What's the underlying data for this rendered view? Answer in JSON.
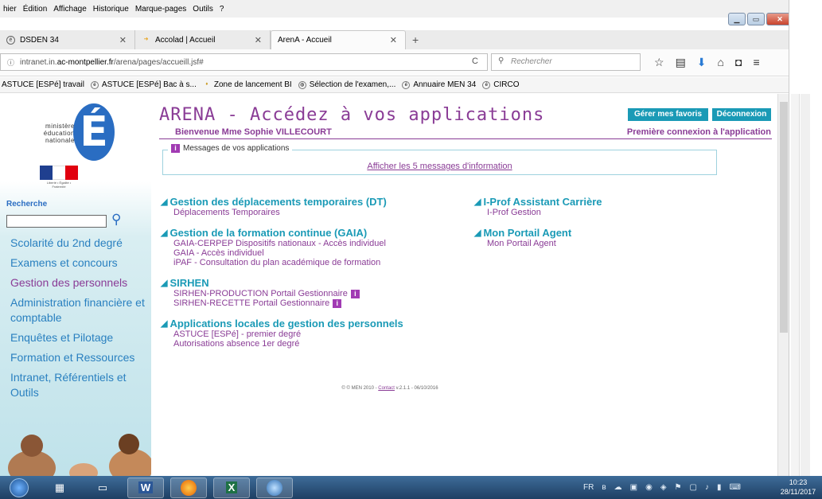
{
  "browser": {
    "menu": [
      "hier",
      "Édition",
      "Affichage",
      "Historique",
      "Marque-pages",
      "Outils",
      "?"
    ],
    "tabs": [
      {
        "label": "DSDEN 34"
      },
      {
        "label": "Accolad | Accueil"
      },
      {
        "label": "ArenA - Accueil"
      }
    ],
    "url_prefix": "intranet.in.",
    "url_domain": "ac-montpellier.fr",
    "url_path": "/arena/pages/accueill.jsf#",
    "search_placeholder": "Rechercher",
    "bookmarks": [
      "ASTUCE [ESPé] travail",
      "ASTUCE [ESPé] Bac à s...",
      "Zone de lancement BI",
      "Sélection de l'examen,...",
      "Annuaire MEN 34",
      "CIRCO"
    ]
  },
  "sidebar": {
    "logo_text": "ministère éducation nationale",
    "logo_letter": "É",
    "marianne_caption": "Liberté • Égalité • Fraternité RÉPUBLIQUE FRANÇAISE",
    "search_label": "Recherche",
    "menu": [
      "Scolarité du 2nd degré",
      "Examens et concours",
      "Gestion des personnels",
      "Administration financière et comptable",
      "Enquêtes et Pilotage",
      "Formation et Ressources",
      "Intranet, Référentiels et Outils"
    ]
  },
  "main": {
    "title": "ARENA - Accédez à vos applications",
    "favorites_button": "Gérer mes favoris",
    "logout_button": "Déconnexion",
    "welcome": "Bienvenue Mme Sophie VILLECOURT",
    "first_connection": "Première connexion à l'application",
    "messages_legend": "Messages de vos applications",
    "messages_link": "Afficher les 5 messages d'information",
    "groups_left": [
      {
        "title": "Gestion des déplacements temporaires (DT)",
        "links": [
          "Déplacements Temporaires"
        ]
      },
      {
        "title": "Gestion de la formation continue (GAIA)",
        "links": [
          "GAIA-CERPEP Dispositifs nationaux - Accès individuel",
          "GAIA - Accès individuel",
          "iPAF - Consultation du plan académique de formation"
        ]
      },
      {
        "title": "SIRHEN",
        "links": [
          "SIRHEN-PRODUCTION Portail Gestionnaire",
          "SIRHEN-RECETTE Portail Gestionnaire"
        ]
      },
      {
        "title": "Applications locales de gestion des personnels",
        "links": [
          "ASTUCE [ESPé] - premier degré",
          "Autorisations absence 1er degré"
        ]
      }
    ],
    "groups_right": [
      {
        "title": "I-Prof Assistant Carrière",
        "links": [
          "I-Prof Gestion"
        ]
      },
      {
        "title": "Mon Portail Agent",
        "links": [
          "Mon Portail Agent"
        ]
      }
    ],
    "footer_pre": "© © MEN 2010 - ",
    "footer_link": "Contact",
    "footer_post": " v.2.1.1 - 06/10/2016"
  },
  "taskbar": {
    "lang": "FR",
    "time": "10:23",
    "date": "28/11/2017"
  },
  "colors": {
    "accent_purple": "#8a3c96",
    "accent_teal": "#1a9ab6",
    "link_blue": "#2a80c0"
  }
}
